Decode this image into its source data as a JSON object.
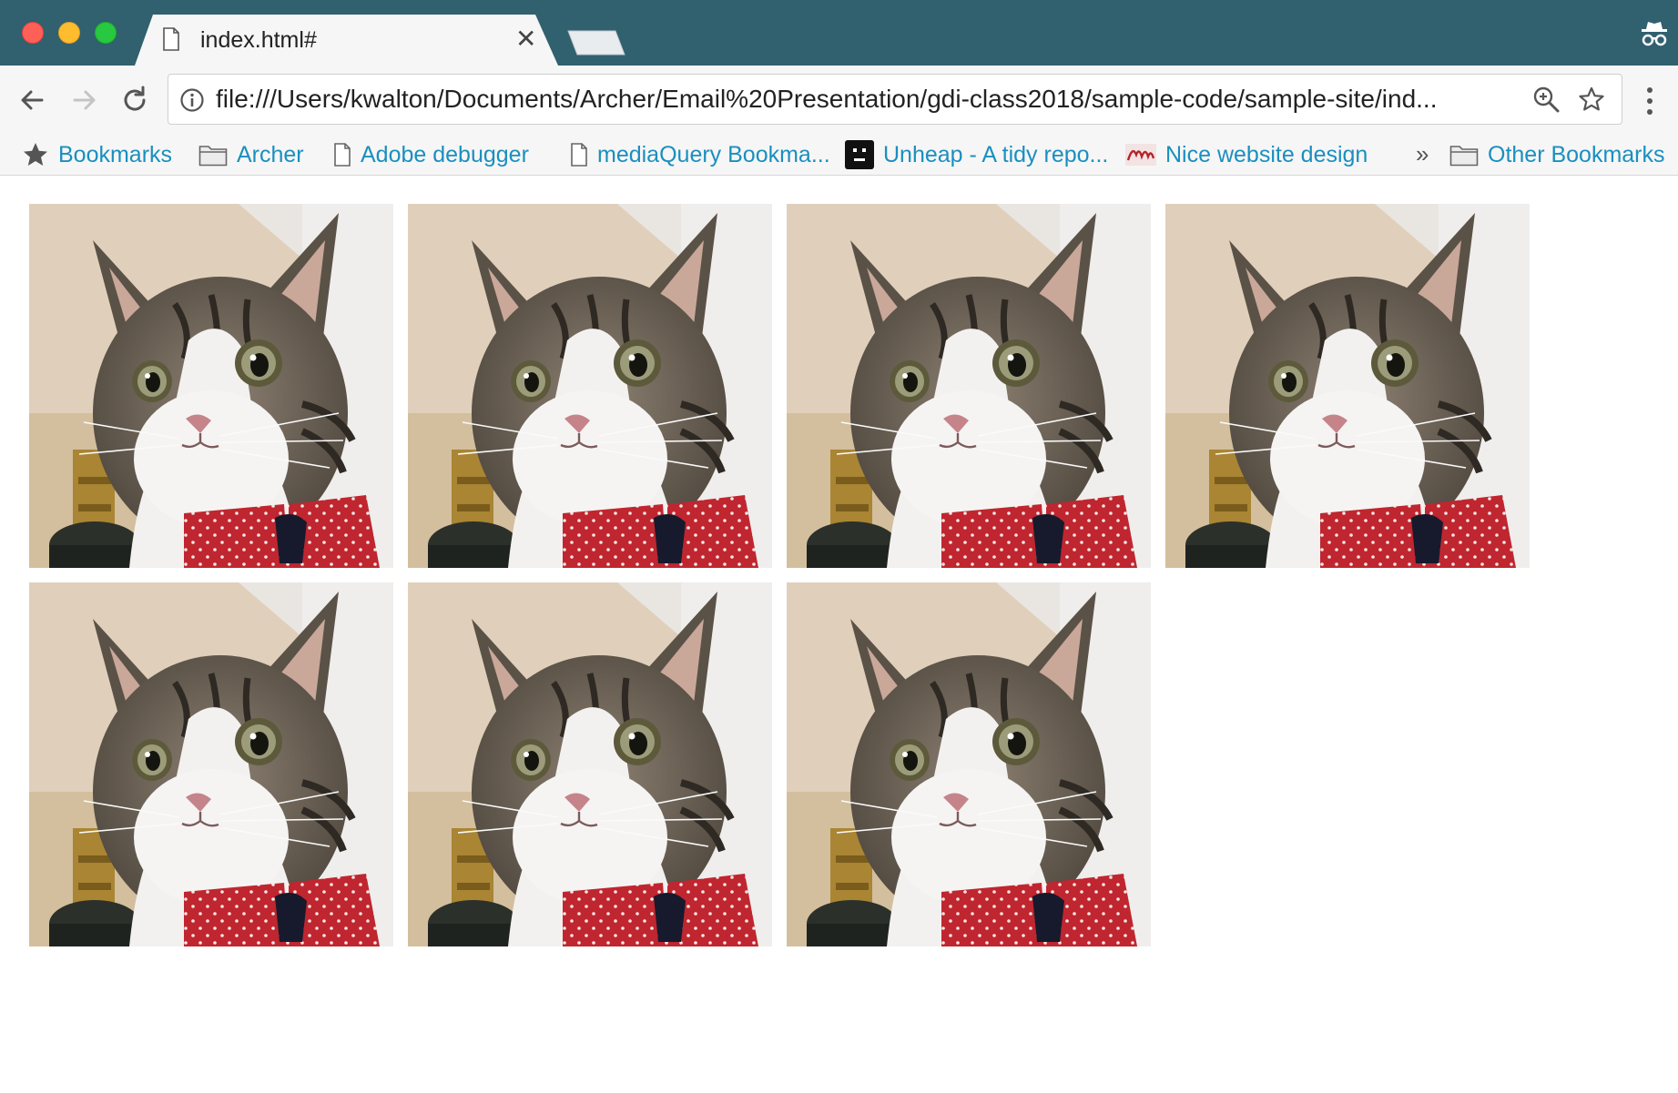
{
  "window": {
    "tab_title": "index.html#"
  },
  "toolbar": {
    "url": "file:///Users/kwalton/Documents/Archer/Email%20Presentation/gdi-class2018/sample-code/sample-site/ind..."
  },
  "bookmarks": {
    "items": [
      {
        "label": "Bookmarks",
        "icon": "star-icon"
      },
      {
        "label": "Archer",
        "icon": "folder-icon"
      },
      {
        "label": "Adobe debugger",
        "icon": "page-icon"
      },
      {
        "label": "mediaQuery Bookma...",
        "icon": "page-icon"
      },
      {
        "label": "Unheap - A tidy repo...",
        "icon": "unheap-favicon"
      },
      {
        "label": "Nice website design",
        "icon": "rons-favicon"
      }
    ],
    "other_label": "Other Bookmarks"
  },
  "gallery": {
    "images": [
      {
        "alt": "cat photo"
      },
      {
        "alt": "cat photo"
      },
      {
        "alt": "cat photo"
      },
      {
        "alt": "cat photo"
      },
      {
        "alt": "cat photo"
      },
      {
        "alt": "cat photo"
      },
      {
        "alt": "cat photo"
      }
    ]
  },
  "colors": {
    "titlebar": "#31606f",
    "link": "#1a8fbf",
    "bowtie": "#c0262f"
  }
}
